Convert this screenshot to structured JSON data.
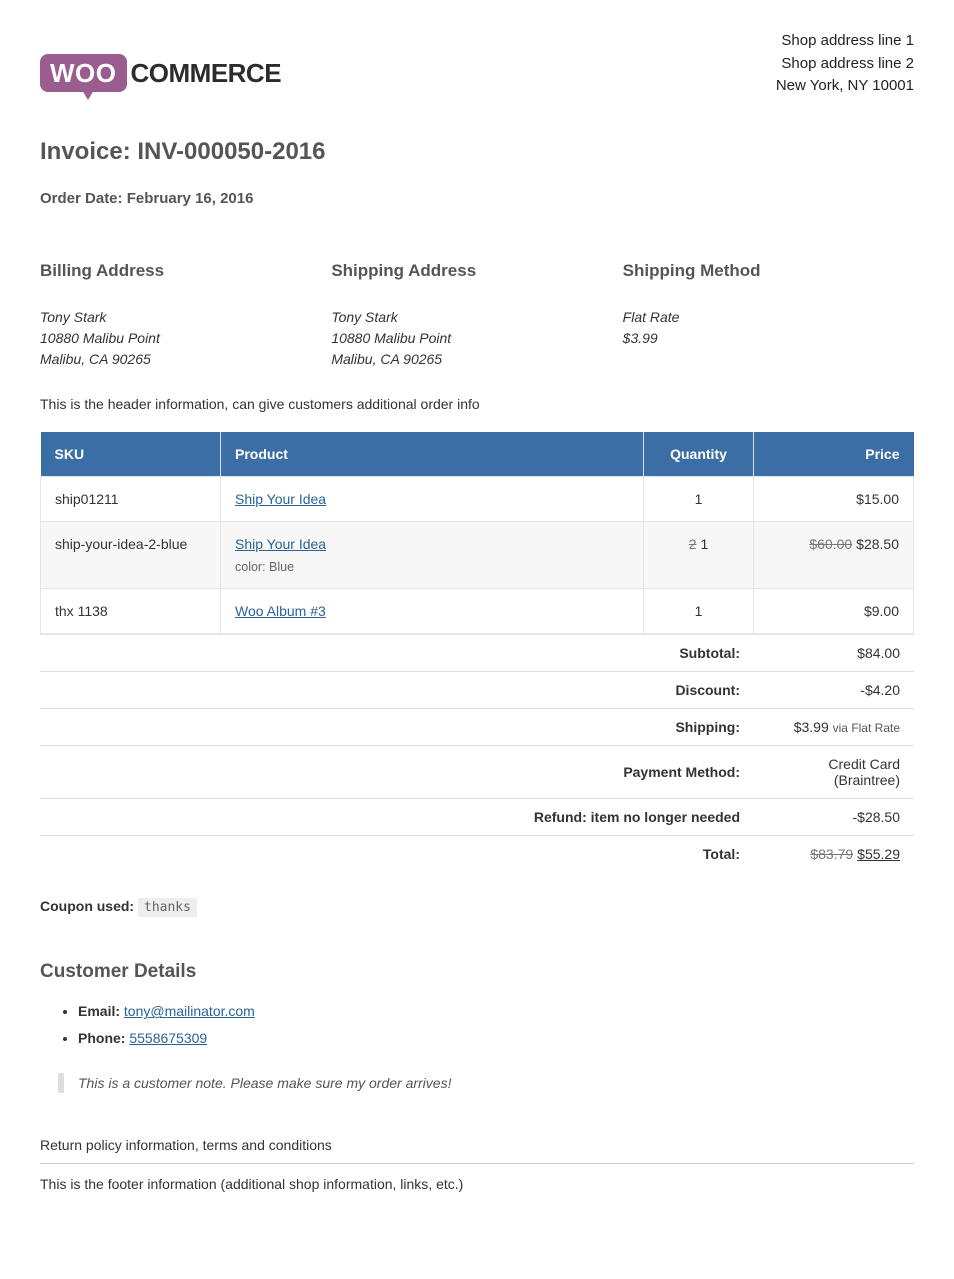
{
  "shop_address": {
    "line1": "Shop address line 1",
    "line2": "Shop address line 2",
    "line3": "New York, NY 10001"
  },
  "logo": {
    "bubble": "WOO",
    "text": "COMMERCE"
  },
  "invoice_title": "Invoice: INV-000050-2016",
  "order_date_label": "Order Date: February 16, 2016",
  "columns": {
    "billing": "Billing Address",
    "shipping": "Shipping Address",
    "method": "Shipping Method"
  },
  "billing": {
    "name": "Tony Stark",
    "street": "10880 Malibu Point",
    "city": "Malibu, CA 90265"
  },
  "shipping": {
    "name": "Tony Stark",
    "street": "10880 Malibu Point",
    "city": "Malibu, CA 90265"
  },
  "shipping_method": {
    "name": "Flat Rate",
    "cost": "$3.99"
  },
  "header_info": "This is the header information, can give customers additional order info",
  "table": {
    "headers": {
      "sku": "SKU",
      "product": "Product",
      "qty": "Quantity",
      "price": "Price"
    },
    "rows": [
      {
        "sku": "ship01211",
        "product": "Ship Your Idea",
        "meta": "",
        "qty_old": "",
        "qty": "1",
        "price_old": "",
        "price": "$15.00"
      },
      {
        "sku": "ship-your-idea-2-blue",
        "product": "Ship Your Idea",
        "meta": "color: Blue",
        "qty_old": "2",
        "qty": "1",
        "price_old": "$60.00",
        "price": "$28.50"
      },
      {
        "sku": "thx 1138",
        "product": "Woo Album #3",
        "meta": "",
        "qty_old": "",
        "qty": "1",
        "price_old": "",
        "price": "$9.00"
      }
    ]
  },
  "totals": {
    "subtotal_label": "Subtotal:",
    "subtotal": "$84.00",
    "discount_label": "Discount:",
    "discount": "-$4.20",
    "shipping_label": "Shipping:",
    "shipping_amount": "$3.99",
    "shipping_via": "via Flat Rate",
    "payment_label": "Payment Method:",
    "payment": "Credit Card (Braintree)",
    "refund_label": "Refund: item no longer needed",
    "refund": "-$28.50",
    "total_label": "Total:",
    "total_old": "$83.79",
    "total": "$55.29"
  },
  "coupon": {
    "label": "Coupon used:",
    "code": "thanks"
  },
  "customer": {
    "heading": "Customer Details",
    "email_label": "Email:",
    "email": "tony@mailinator.com",
    "phone_label": "Phone:",
    "phone": "5558675309",
    "note": "This is a customer note. Please make sure my order arrives!"
  },
  "policy": "Return policy information, terms and conditions",
  "footer": "This is the footer information (additional shop information, links, etc.)"
}
